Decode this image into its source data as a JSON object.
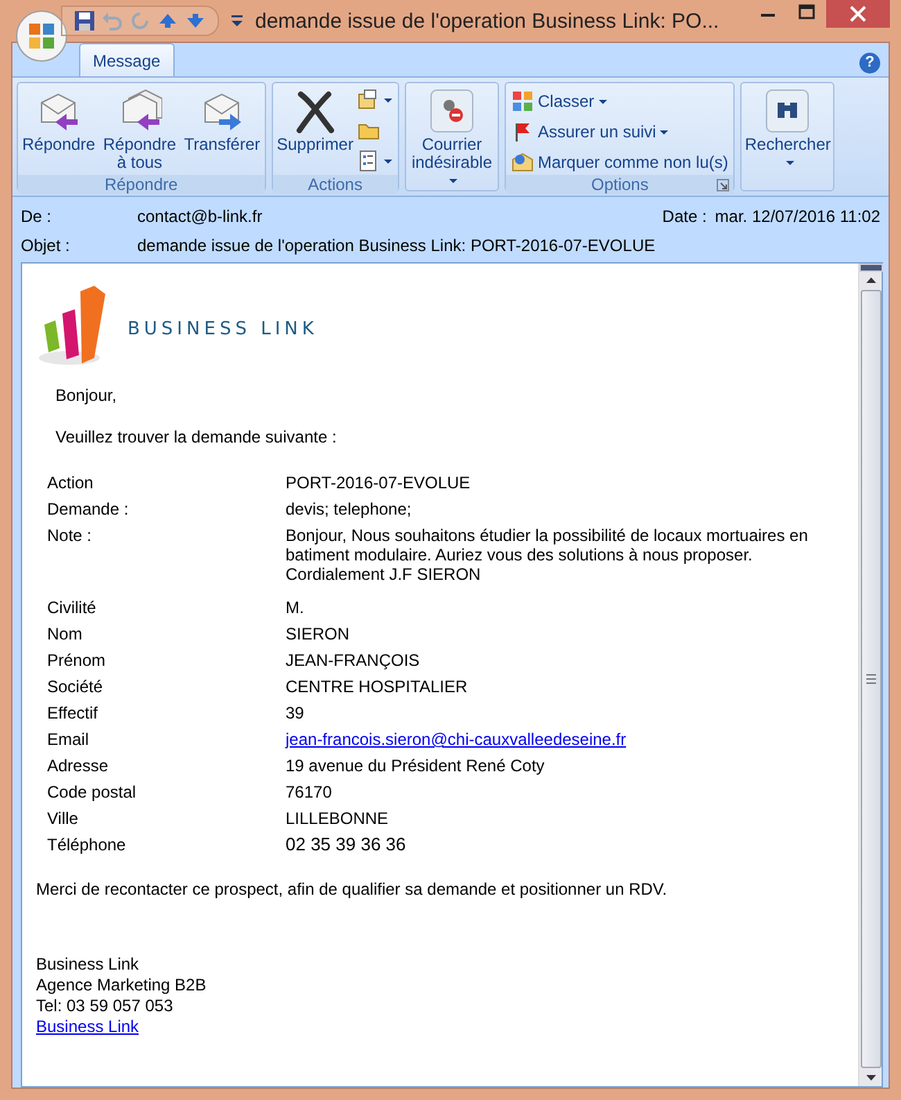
{
  "window": {
    "title": "demande issue de l'operation Business Link: PO..."
  },
  "tabs": [
    {
      "label": "Message",
      "selected": true
    }
  ],
  "help": "?",
  "ribbon": [
    {
      "label": "Répondre",
      "items": [
        {
          "kind": "large",
          "label": "Répondre",
          "dropdown": false
        },
        {
          "kind": "large",
          "label": "Répondre à tous",
          "dropdown": false
        },
        {
          "kind": "large",
          "label": "Transférer",
          "dropdown": false
        }
      ]
    },
    {
      "label": "Actions",
      "items": [
        {
          "kind": "large",
          "label": "Supprimer",
          "dropdown": false
        },
        {
          "kind": "iconstack"
        }
      ]
    },
    {
      "items": [
        {
          "kind": "large",
          "label": "Courrier indésirable",
          "dropdown": true
        }
      ]
    },
    {
      "label": "Options",
      "launcher": true,
      "items": [
        {
          "kind": "list",
          "rows": [
            {
              "label": "Classer",
              "dropdown": true
            },
            {
              "label": "Assurer un suivi",
              "dropdown": true
            },
            {
              "label": "Marquer comme non lu(s)",
              "dropdown": false
            }
          ]
        }
      ]
    },
    {
      "items": [
        {
          "kind": "large",
          "label": "Rechercher",
          "dropdown": true
        }
      ]
    }
  ],
  "header": {
    "from_label": "De :",
    "from": "contact@b-link.fr",
    "date_label": "Date :",
    "date": "mar. 12/07/2016 11:02",
    "subject_label": "Objet :",
    "subject": "demande issue de l'operation Business Link: PORT-2016-07-EVOLUE"
  },
  "body": {
    "logo_text": "BUSINESS LINK",
    "greeting": "Bonjour,",
    "intro": "Veuillez trouver la demande suivante :",
    "fields": [
      {
        "label": "Action",
        "value": "PORT-2016-07-EVOLUE",
        "kind": "text"
      },
      {
        "label": "Demande :",
        "value": "devis;  telephone;",
        "kind": "text"
      },
      {
        "label": "Note :",
        "value": "Bonjour, Nous souhaitons étudier la possibilité de locaux mortuaires en batiment modulaire. Auriez vous des solutions à nous proposer. Cordialement J.F SIERON",
        "kind": "text"
      },
      {
        "label": "Civilité",
        "value": "M.",
        "kind": "text"
      },
      {
        "label": "Nom",
        "value": "SIERON",
        "kind": "text"
      },
      {
        "label": "Prénom",
        "value": "JEAN-FRANÇOIS",
        "kind": "text"
      },
      {
        "label": "Société",
        "value": "CENTRE HOSPITALIER",
        "kind": "text"
      },
      {
        "label": "Effectif",
        "value": "39",
        "kind": "text"
      },
      {
        "label": "Email",
        "value": "jean-francois.sieron@chi-cauxvalleedeseine.fr",
        "kind": "link"
      },
      {
        "label": "Adresse",
        "value": "19 avenue du Président René Coty",
        "kind": "text"
      },
      {
        "label": "Code postal",
        "value": "76170",
        "kind": "text"
      },
      {
        "label": "Ville",
        "value": "LILLEBONNE",
        "kind": "text"
      },
      {
        "label": "Téléphone",
        "value": "02 35 39 36 36",
        "kind": "phone"
      }
    ],
    "closing": "Merci de recontacter ce prospect, afin de qualifier sa demande et positionner un RDV.",
    "signature": [
      "Business Link",
      "Agence Marketing B2B",
      "Tel: 03 59 057 053"
    ],
    "signature_link": "Business Link"
  }
}
